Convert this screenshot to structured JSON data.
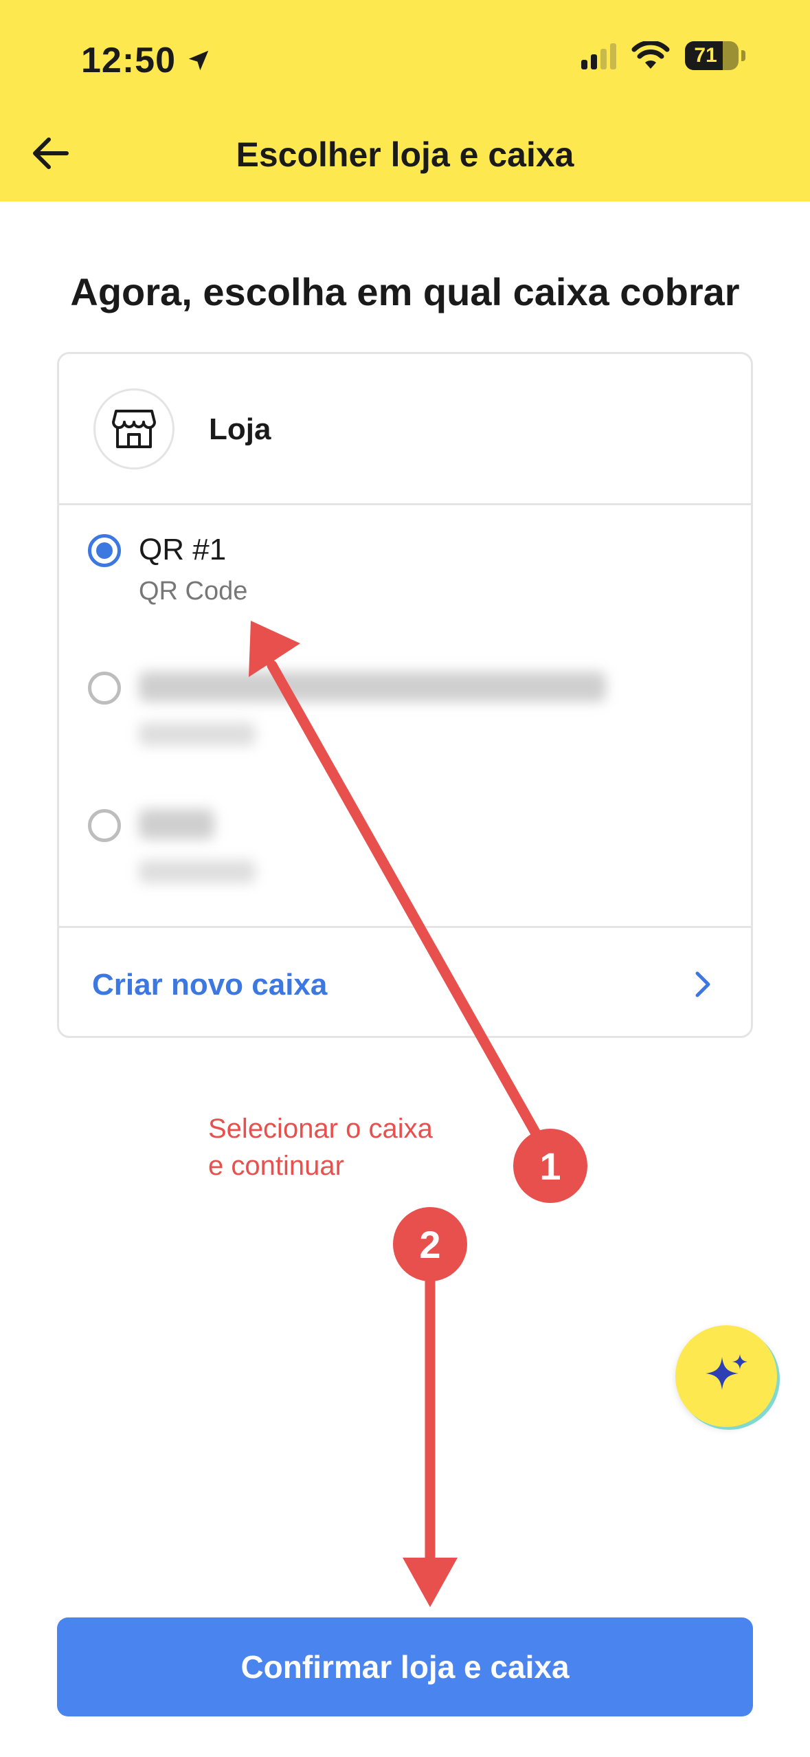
{
  "status_bar": {
    "time": "12:50",
    "battery": "71",
    "battery_level": 0.71
  },
  "header": {
    "title": "Escolher loja e caixa",
    "back_icon": "arrow-left-icon",
    "background": "#fde84f"
  },
  "page": {
    "title": "Agora, escolha em qual caixa cobrar"
  },
  "store": {
    "label": "Loja",
    "icon": "store-icon"
  },
  "options": [
    {
      "title": "QR #1",
      "subtitle": "QR Code",
      "selected": true
    },
    {
      "title": "",
      "subtitle": "",
      "selected": false,
      "redacted": true
    },
    {
      "title": "",
      "subtitle": "",
      "selected": false,
      "redacted": true
    }
  ],
  "create_box": {
    "label": "Criar novo caixa",
    "icon": "chevron-right-icon"
  },
  "annotation": {
    "line1": "Selecionar o caixa",
    "line2": "e continuar",
    "badge1": "1",
    "badge2": "2",
    "color": "#e8504e"
  },
  "assistant": {
    "icon": "sparkle-icon"
  },
  "confirm_button": {
    "label": "Confirmar loja e caixa",
    "color": "#4a84ee"
  }
}
